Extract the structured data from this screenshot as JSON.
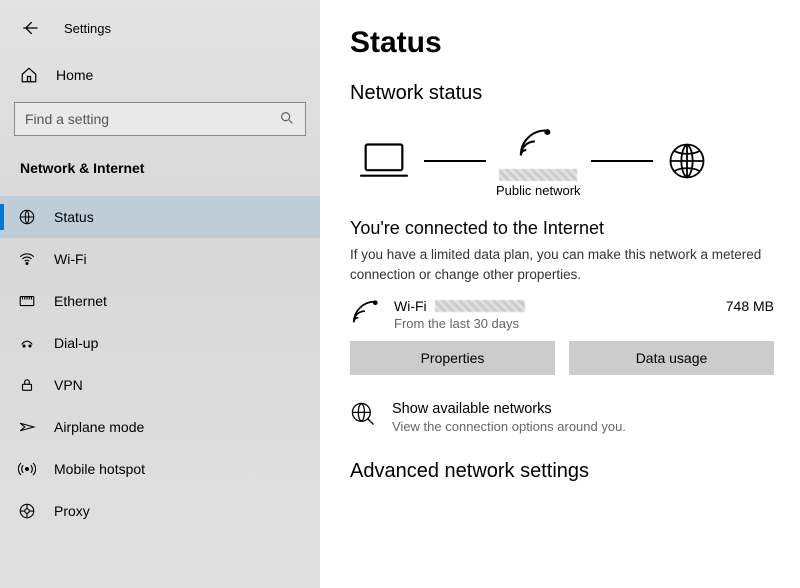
{
  "window": {
    "title": "Settings"
  },
  "sidebar": {
    "home": "Home",
    "search_placeholder": "Find a setting",
    "section": "Network & Internet",
    "items": [
      {
        "label": "Status"
      },
      {
        "label": "Wi-Fi"
      },
      {
        "label": "Ethernet"
      },
      {
        "label": "Dial-up"
      },
      {
        "label": "VPN"
      },
      {
        "label": "Airplane mode"
      },
      {
        "label": "Mobile hotspot"
      },
      {
        "label": "Proxy"
      }
    ]
  },
  "main": {
    "title": "Status",
    "status_heading": "Network status",
    "diagram": {
      "public_network": "Public network"
    },
    "connected_title": "You're connected to the Internet",
    "connected_desc": "If you have a limited data plan, you can make this network a metered connection or change other properties.",
    "connection": {
      "type": "Wi-Fi",
      "subtext": "From the last 30 days",
      "usage": "748 MB"
    },
    "buttons": {
      "properties": "Properties",
      "data_usage": "Data usage"
    },
    "available": {
      "title": "Show available networks",
      "subtitle": "View the connection options around you."
    },
    "advanced_heading": "Advanced network settings"
  }
}
